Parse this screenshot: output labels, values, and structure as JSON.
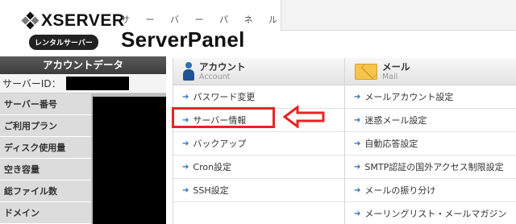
{
  "header": {
    "brand": "XSERVER",
    "rental_badge": "レンタルサーバー",
    "panel_kana": "サ ー バ ー パ ネ ル",
    "panel_title": "ServerPanel"
  },
  "account_panel": {
    "title": "アカウントデータ",
    "server_id_label": "サーバーID：",
    "rows": [
      "サーバー番号",
      "ご利用プラン",
      "ディスク使用量",
      "空き容量",
      "総ファイル数",
      "ドメイン"
    ]
  },
  "menu": {
    "account": {
      "title": "アカウント",
      "subtitle": "Account",
      "items": [
        "パスワード変更",
        "サーバー情報",
        "バックアップ",
        "Cron設定",
        "SSH設定"
      ]
    },
    "mail": {
      "title": "メール",
      "subtitle": "Mail",
      "items": [
        "メールアカウント設定",
        "迷惑メール設定",
        "自動応答設定",
        "SMTP認証の国外アクセス制限設定",
        "メールの振り分け",
        "メーリングリスト・メールマガジン"
      ]
    }
  },
  "colors": {
    "accent": "#2f6eb6",
    "highlight": "#e52523",
    "header_dark": "#3c3c3c"
  },
  "icons": {
    "item_arrow": "arrow-right-icon",
    "account": "person-icon",
    "mail": "envelope-icon"
  }
}
